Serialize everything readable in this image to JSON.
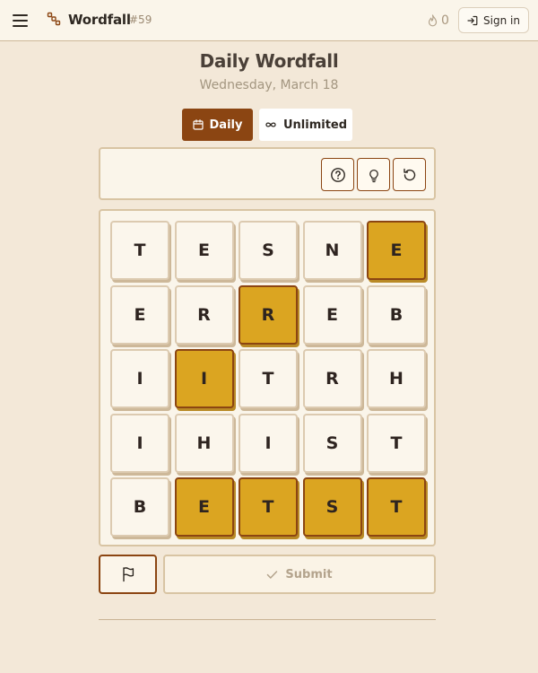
{
  "header": {
    "brand": "Wordfall",
    "issue": "#59",
    "streak_count": "0",
    "signin_label": "Sign in"
  },
  "title": "Daily Wordfall",
  "date": "Wednesday, March 18",
  "tabs": [
    {
      "label": "Daily",
      "active": true,
      "icon": "calendar-icon"
    },
    {
      "label": "Unlimited",
      "active": false,
      "icon": "infinity-icon"
    }
  ],
  "tools": [
    {
      "name": "help-button",
      "icon": "question-icon"
    },
    {
      "name": "hint-button",
      "icon": "lightbulb-icon"
    },
    {
      "name": "reset-button",
      "icon": "undo-icon"
    }
  ],
  "grid": [
    [
      {
        "letter": "T",
        "selected": false
      },
      {
        "letter": "E",
        "selected": false
      },
      {
        "letter": "S",
        "selected": false
      },
      {
        "letter": "N",
        "selected": false
      },
      {
        "letter": "E",
        "selected": true
      }
    ],
    [
      {
        "letter": "E",
        "selected": false
      },
      {
        "letter": "R",
        "selected": false
      },
      {
        "letter": "R",
        "selected": true
      },
      {
        "letter": "E",
        "selected": false
      },
      {
        "letter": "B",
        "selected": false
      }
    ],
    [
      {
        "letter": "I",
        "selected": false
      },
      {
        "letter": "I",
        "selected": true
      },
      {
        "letter": "T",
        "selected": false
      },
      {
        "letter": "R",
        "selected": false
      },
      {
        "letter": "H",
        "selected": false
      }
    ],
    [
      {
        "letter": "I",
        "selected": false
      },
      {
        "letter": "H",
        "selected": false
      },
      {
        "letter": "I",
        "selected": false
      },
      {
        "letter": "S",
        "selected": false
      },
      {
        "letter": "T",
        "selected": false
      }
    ],
    [
      {
        "letter": "B",
        "selected": false
      },
      {
        "letter": "E",
        "selected": true
      },
      {
        "letter": "T",
        "selected": true
      },
      {
        "letter": "S",
        "selected": true
      },
      {
        "letter": "T",
        "selected": true
      }
    ]
  ],
  "actions": {
    "submit_label": "Submit"
  },
  "colors": {
    "accent": "#8b4512",
    "selected_tile": "#dba521",
    "background": "#f3e8d8"
  }
}
